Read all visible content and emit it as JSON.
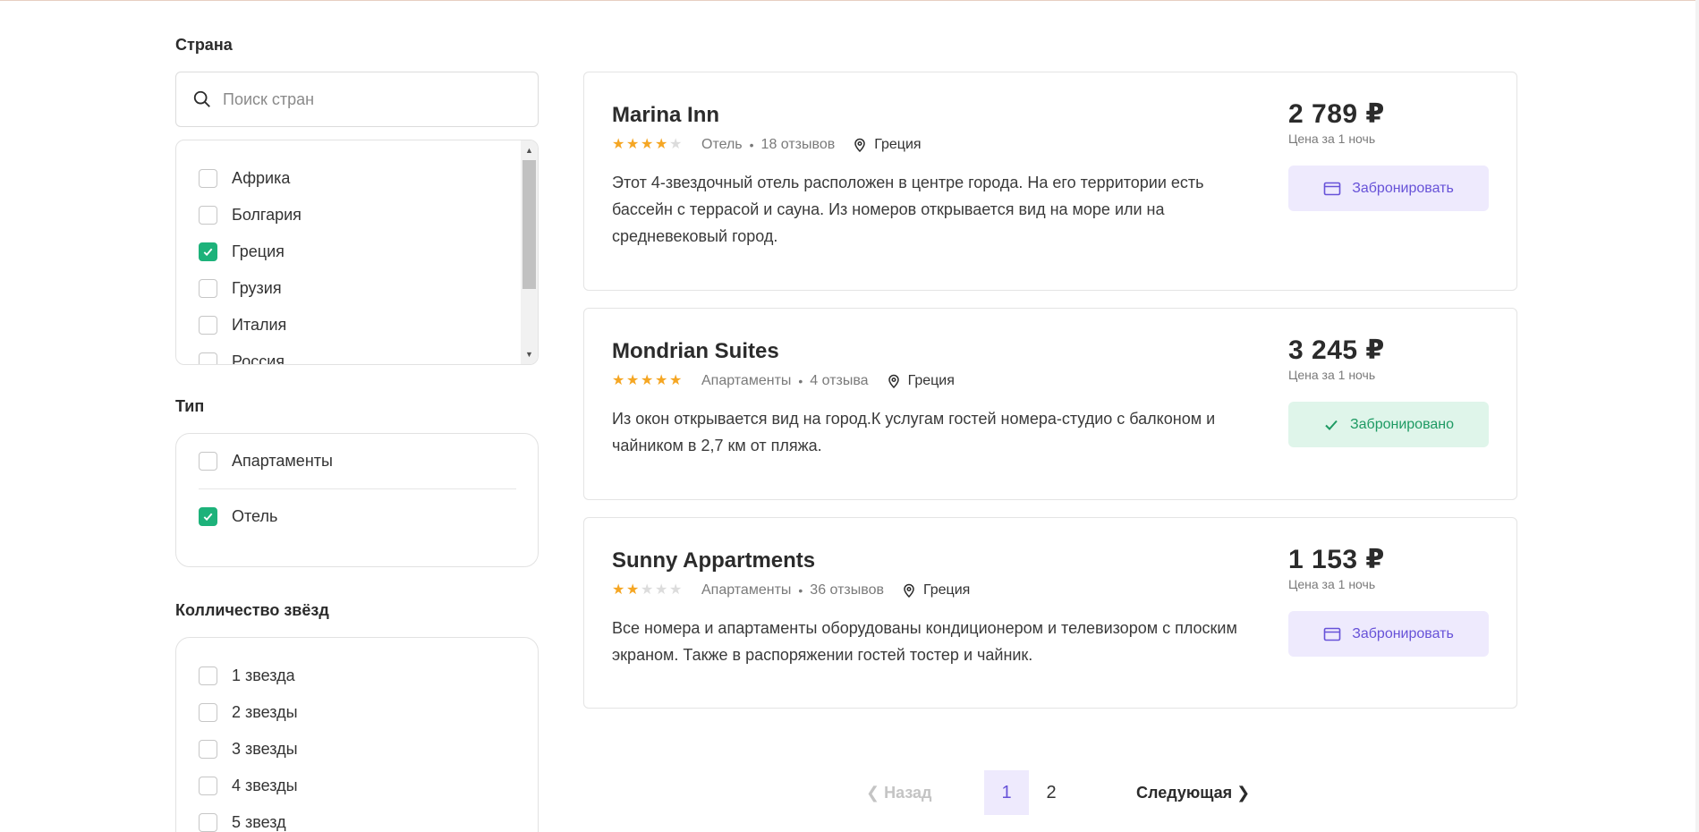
{
  "filters": {
    "country": {
      "title": "Страна",
      "search_placeholder": "Поиск стран",
      "items": [
        {
          "label": "Африка",
          "checked": false
        },
        {
          "label": "Болгария",
          "checked": false
        },
        {
          "label": "Греция",
          "checked": true
        },
        {
          "label": "Грузия",
          "checked": false
        },
        {
          "label": "Италия",
          "checked": false
        },
        {
          "label": "Россия",
          "checked": false
        }
      ]
    },
    "type": {
      "title": "Тип",
      "items": [
        {
          "label": "Апартаменты",
          "checked": false
        },
        {
          "label": "Отель",
          "checked": true
        }
      ]
    },
    "stars": {
      "title": "Колличество звёзд",
      "items": [
        {
          "label": "1 звезда",
          "checked": false
        },
        {
          "label": "2 звезды",
          "checked": false
        },
        {
          "label": "3 звезды",
          "checked": false
        },
        {
          "label": "4 звезды",
          "checked": false
        },
        {
          "label": "5 звезд",
          "checked": false
        }
      ]
    }
  },
  "hotels": [
    {
      "name": "Marina Inn",
      "rating": 4,
      "type": "Отель",
      "reviews": "18 отзывов",
      "location": "Греция",
      "description": "Этот 4-звездочный отель расположен в центре города. На его территории есть бассейн с террасой и сауна. Из номеров открывается вид на море или на средневековый город.",
      "price": "2 789 ₽",
      "price_note": "Цена за 1 ночь",
      "button_label": "Забронировать",
      "booked": false
    },
    {
      "name": "Mondrian Suites",
      "rating": 5,
      "type": "Апартаменты",
      "reviews": "4 отзыва",
      "location": "Греция",
      "description": "Из окон открывается вид на город.К услугам гостей номера-студио с балконом и чайником в 2,7 км от пляжа.",
      "price": "3 245 ₽",
      "price_note": "Цена за 1 ночь",
      "button_label": "Забронировано",
      "booked": true
    },
    {
      "name": "Sunny Appartments",
      "rating": 2,
      "type": "Апартаменты",
      "reviews": "36 отзывов",
      "location": "Греция",
      "description": "Все номера и апартаменты оборудованы кондиционером и телевизором с плоским экраном. Также в распоряжении гостей тостер и чайник.",
      "price": "1 153 ₽",
      "price_note": "Цена за 1 ночь",
      "button_label": "Забронировать",
      "booked": false
    }
  ],
  "pagination": {
    "prev_label": "Назад",
    "pages": [
      "1",
      "2"
    ],
    "current_page": "1",
    "next_label": "Следующая"
  },
  "colors": {
    "accent": "#6752d8",
    "accent_bg": "#eeeafd",
    "success": "#1db27a",
    "star": "#f5a623"
  }
}
